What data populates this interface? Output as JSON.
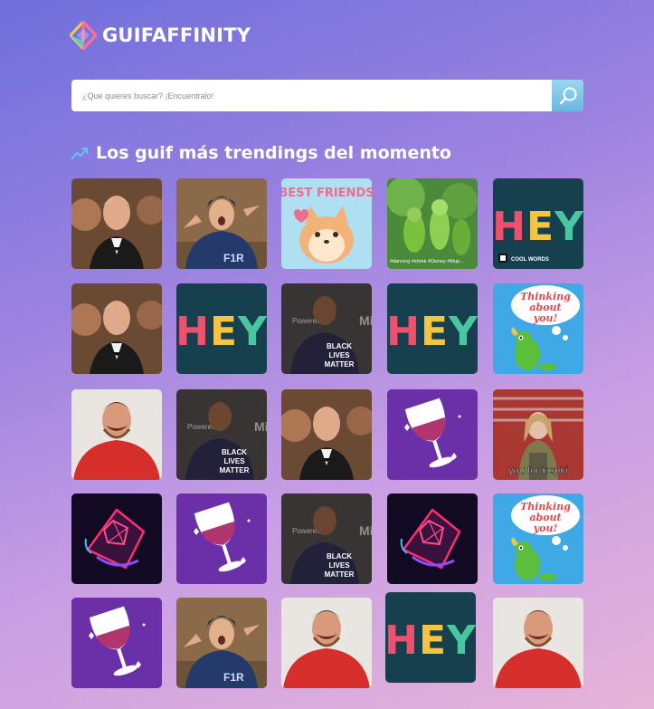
{
  "brand": {
    "name": "GUIFAFFINITY"
  },
  "search": {
    "placeholder": "¿Que quieres buscar? ¡Encuentralo!"
  },
  "section": {
    "title": "Los guif más trendings del momento"
  },
  "gifs": [
    {
      "type": "man-suit"
    },
    {
      "type": "cyclist"
    },
    {
      "type": "best-friends",
      "text": "BEST FRIENDS"
    },
    {
      "type": "shrek",
      "text": "#dancing #shrek #Disney #Mup..."
    },
    {
      "type": "hey",
      "text": "HEY",
      "caption": "COOL WORDS"
    },
    {
      "type": "man-suit"
    },
    {
      "type": "hey",
      "text": "HEY"
    },
    {
      "type": "lebron",
      "text": "BLACK LIVES MATTER",
      "powered": "Powered by"
    },
    {
      "type": "hey",
      "text": "HEY"
    },
    {
      "type": "thinking",
      "text": "Thinking about you!"
    },
    {
      "type": "red-shirt"
    },
    {
      "type": "lebron",
      "text": "BLACK LIVES MATTER",
      "powered": "Powered by"
    },
    {
      "type": "man-suit"
    },
    {
      "type": "wine"
    },
    {
      "type": "speech",
      "text": "you for inspiri"
    },
    {
      "type": "neon"
    },
    {
      "type": "wine"
    },
    {
      "type": "lebron",
      "text": "BLACK LIVES MATTER",
      "powered": "Powered by"
    },
    {
      "type": "neon"
    },
    {
      "type": "thinking",
      "text": "Thinking about you!"
    },
    {
      "type": "wine"
    },
    {
      "type": "cyclist"
    },
    {
      "type": "red-shirt"
    },
    {
      "type": "hey",
      "text": "HEY"
    },
    {
      "type": "red-shirt"
    }
  ]
}
